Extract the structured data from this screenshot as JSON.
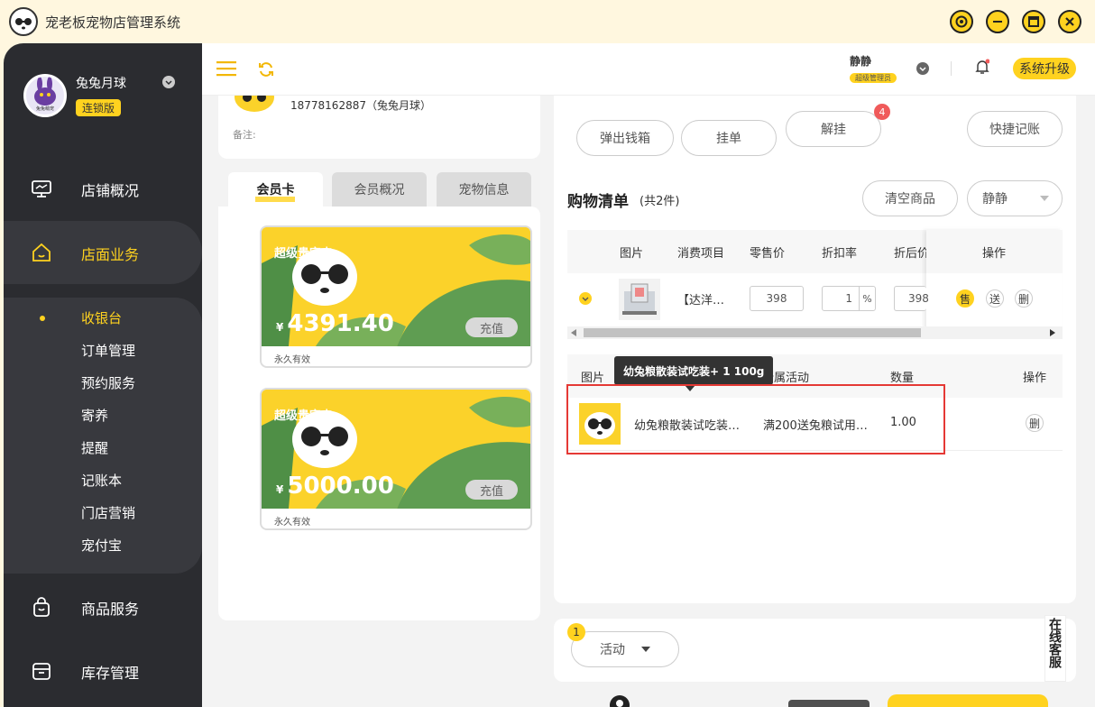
{
  "app": {
    "title": "宠老板宠物店管理系统"
  },
  "sidebar": {
    "user_name": "兔兔月球",
    "edition": "连锁版",
    "avatar_text": "兔兔萌宠",
    "nav": [
      {
        "label": "店铺概况",
        "icon": "monitor-icon"
      },
      {
        "label": "店面业务",
        "icon": "house-icon"
      },
      {
        "label": "商品服务",
        "icon": "bag-icon"
      },
      {
        "label": "库存管理",
        "icon": "box-icon"
      }
    ],
    "sub_items": [
      "收银台",
      "订单管理",
      "预约服务",
      "寄养",
      "提醒",
      "记账本",
      "门店营销",
      "宠付宝"
    ]
  },
  "topbar": {
    "operator_name": "静静",
    "operator_role": "超级管理员",
    "upgrade_label": "系统升级"
  },
  "member": {
    "phone": "18778162887（兔兔月球）",
    "note_label": "备注:"
  },
  "tabs": [
    "会员卡",
    "会员概况",
    "宠物信息"
  ],
  "cards": [
    {
      "title": "超级贵宾卡",
      "currency": "¥",
      "amount": "4391.40",
      "recharge": "充值",
      "validity": "永久有效"
    },
    {
      "title": "超级贵宾卡",
      "currency": "¥",
      "amount": "5000.00",
      "recharge": "充值",
      "validity": "永久有效"
    }
  ],
  "actions": {
    "cash_drawer": "弹出钱箱",
    "hold": "挂单",
    "unhold": "解挂",
    "unhold_badge": "4",
    "quick_record": "快捷记账"
  },
  "cart": {
    "title": "购物清单",
    "count_text": "(共2件)",
    "clear_label": "清空商品",
    "staff_select": "静静",
    "columns": [
      "图片",
      "消费项目",
      "零售价",
      "折扣率",
      "折后价",
      "操作"
    ],
    "rows": [
      {
        "name": "【达洋…",
        "retail": "398",
        "discount": "1",
        "discount_unit": "%",
        "final": "398",
        "op_sell": "售",
        "op_gift": "送",
        "op_delete": "删"
      }
    ]
  },
  "promo": {
    "tooltip": "幼兔粮散装试吃装+ 1 100g",
    "columns": [
      "图片",
      "所属活动",
      "数量",
      "操作"
    ],
    "rows": [
      {
        "name": "幼兔粮散装试吃装…",
        "activity": "满200送兔粮试用…",
        "qty": "1.00",
        "op_delete": "删"
      }
    ]
  },
  "bottom": {
    "activity_badge": "1",
    "activity_label": "活动",
    "online_service": "在线客服"
  },
  "colors": {
    "accent": "#ffd21f",
    "sidebar": "#2b2c30",
    "highlight_border": "#e53935",
    "badge": "#f05a5a"
  }
}
